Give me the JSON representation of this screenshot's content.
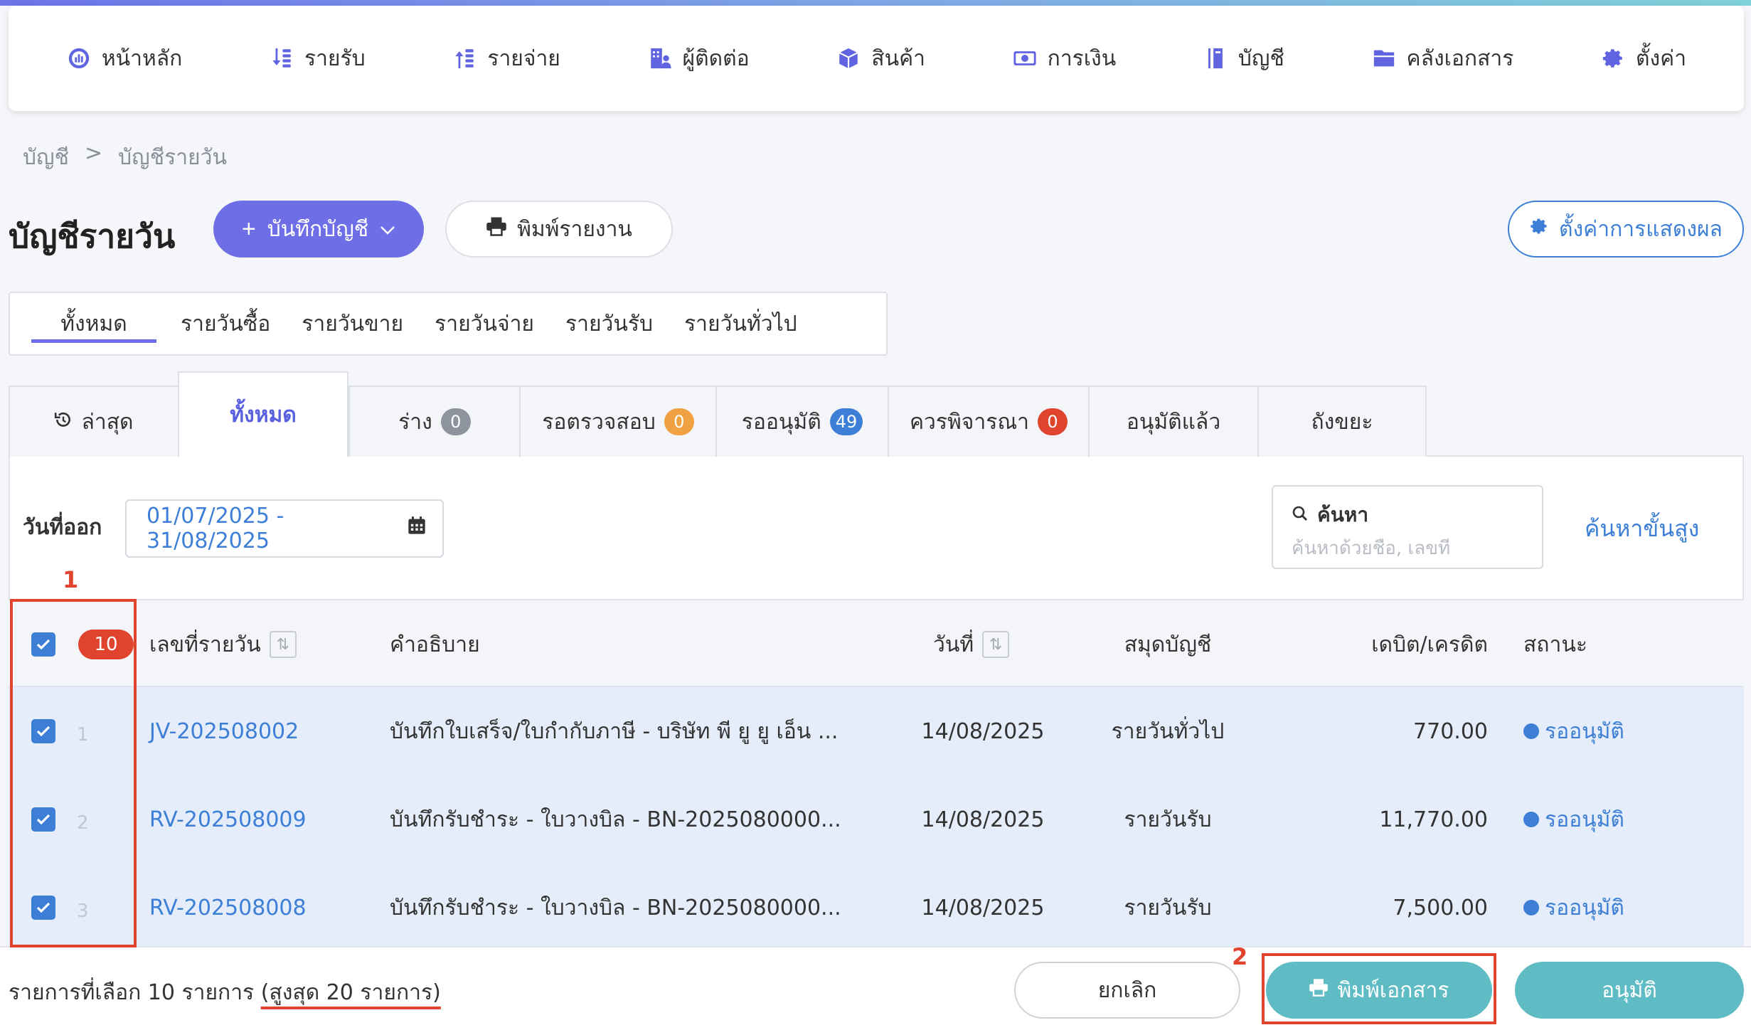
{
  "nav": [
    {
      "label": "หน้าหลัก",
      "icon": "dashboard-icon"
    },
    {
      "label": "รายรับ",
      "icon": "income-icon"
    },
    {
      "label": "รายจ่าย",
      "icon": "expense-icon"
    },
    {
      "label": "ผู้ติดต่อ",
      "icon": "contacts-icon"
    },
    {
      "label": "สินค้า",
      "icon": "product-box-icon"
    },
    {
      "label": "การเงิน",
      "icon": "money-icon"
    },
    {
      "label": "บัญชี",
      "icon": "ledger-book-icon"
    },
    {
      "label": "คลังเอกสาร",
      "icon": "folder-icon"
    },
    {
      "label": "ตั้งค่า",
      "icon": "gear-icon"
    }
  ],
  "breadcrumb": {
    "parent": "บัญชี",
    "separator": ">",
    "current": "บัญชีรายวัน"
  },
  "page": {
    "title": "บัญชีรายวัน",
    "record_button": "บันทึกบัญชี",
    "print_report_button": "พิมพ์รายงาน",
    "display_settings_button": "ตั้งค่าการแสดงผล"
  },
  "journal_tabs": [
    "ทั้งหมด",
    "รายวันซื้อ",
    "รายวันขาย",
    "รายวันจ่าย",
    "รายวันรับ",
    "รายวันทั่วไป"
  ],
  "status_tabs": [
    {
      "label": "ล่าสุด"
    },
    {
      "label": "ทั้งหมด"
    },
    {
      "label": "ร่าง",
      "count": "0",
      "color": "#8e949e"
    },
    {
      "label": "รอตรวจสอบ",
      "count": "0",
      "color": "#f0a242"
    },
    {
      "label": "รออนุมัติ",
      "count": "49",
      "color": "#3d7fd6"
    },
    {
      "label": "ควรพิจารณา",
      "count": "0",
      "color": "#e0442e"
    },
    {
      "label": "อนุมัติแล้ว"
    },
    {
      "label": "ถังขยะ"
    }
  ],
  "filters": {
    "date_label": "วันที่ออก",
    "date_range": "01/07/2025 - 31/08/2025",
    "search_label": "ค้นหา",
    "search_placeholder": "ค้นหาด้วยชื่อ, เลขที่",
    "advanced_search": "ค้นหาขั้นสูง"
  },
  "table": {
    "selected_count": "10",
    "columns": {
      "number": "เลขที่รายวัน",
      "description": "คำอธิบาย",
      "date": "วันที่",
      "book": "สมุดบัญชี",
      "amount": "เดบิต/เครดิต",
      "status": "สถานะ"
    },
    "rows": [
      {
        "index": "1",
        "number": "JV-202508002",
        "description": "บันทึกใบเสร็จ/ใบกำกับภาษี - บริษัท พี ยู ยู เอ็น ...",
        "date": "14/08/2025",
        "book": "รายวันทั่วไป",
        "amount": "770.00",
        "status": "รออนุมัติ"
      },
      {
        "index": "2",
        "number": "RV-202508009",
        "description": "บันทึกรับชำระ - ใบวางบิล - BN-2025080000...",
        "date": "14/08/2025",
        "book": "รายวันรับ",
        "amount": "11,770.00",
        "status": "รออนุมัติ"
      },
      {
        "index": "3",
        "number": "RV-202508008",
        "description": "บันทึกรับชำระ - ใบวางบิล - BN-2025080000...",
        "date": "14/08/2025",
        "book": "รายวันรับ",
        "amount": "7,500.00",
        "status": "รออนุมัติ"
      }
    ]
  },
  "footer": {
    "selected_text": "รายการที่เลือก 10 รายการ",
    "max_text": "(สูงสุด 20 รายการ)",
    "cancel_button": "ยกเลิก",
    "print_doc_button": "พิมพ์เอกสาร",
    "approve_button": "อนุมัติ"
  },
  "annotations": {
    "one": "1",
    "two": "2"
  }
}
